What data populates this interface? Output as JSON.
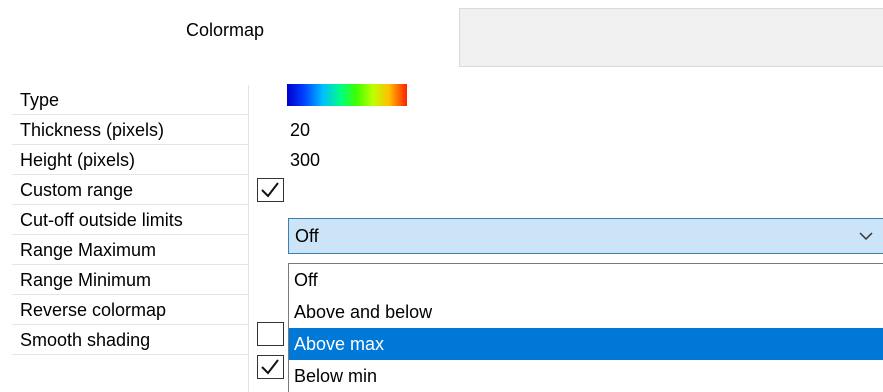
{
  "header": {
    "label": "Colormap"
  },
  "properties": [
    {
      "label": "Type"
    },
    {
      "label": "Thickness (pixels)",
      "value": "20"
    },
    {
      "label": "Height (pixels)",
      "value": "300"
    },
    {
      "label": "Custom range",
      "checked": true
    },
    {
      "label": "Cut-off outside limits"
    },
    {
      "label": "Range Maximum"
    },
    {
      "label": "Range Minimum"
    },
    {
      "label": "Reverse colormap",
      "checked": false
    },
    {
      "label": "Smooth shading",
      "checked": true
    }
  ],
  "colors": {
    "combo_bg": "#cce4f7",
    "selection": "#0078d7"
  },
  "cutoff": {
    "selected": "Off",
    "options": [
      "Off",
      "Above and below",
      "Above max",
      "Below min"
    ],
    "highlighted": "Above max"
  },
  "icons": {
    "dropdown": "chevron-down-icon",
    "check": "checkmark-icon",
    "type": "colormap-gradient"
  }
}
